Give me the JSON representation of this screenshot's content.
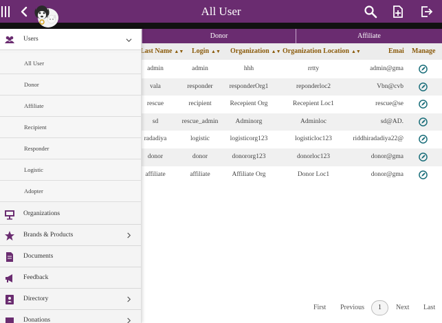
{
  "header": {
    "title": "All User",
    "color": "#6a2c70",
    "icons": [
      "menu-icon",
      "back-icon",
      "search-icon",
      "add-page-icon",
      "logout-icon"
    ]
  },
  "tabs": [
    {
      "label": "Donor"
    },
    {
      "label": "Affiliate"
    }
  ],
  "table": {
    "columns": [
      "Last Name",
      "Login",
      "Organization",
      "Organization Location",
      "Emai",
      "Manage"
    ],
    "rows": [
      {
        "last_name": "admin",
        "login": "admin",
        "organization": "hhh",
        "location": "rrtty",
        "email": "admin@gma"
      },
      {
        "last_name": "vala",
        "login": "responder",
        "organization": "responderOrg1",
        "location": "reponderloc2",
        "email": "Vbn@cvb"
      },
      {
        "last_name": "rescue",
        "login": "recipient",
        "organization": "Recepient Org",
        "location": "Recepient Loc1",
        "email": "rescue@se"
      },
      {
        "last_name": "sd",
        "login": "rescue_admin",
        "organization": "Adminorg",
        "location": "Adminloc",
        "email": "sd@AD."
      },
      {
        "last_name": "radadiya",
        "login": "logistic",
        "organization": "logisticorg123",
        "location": "logisticloc123",
        "email": "riddhiradadiya22@"
      },
      {
        "last_name": "donor",
        "login": "donor",
        "organization": "donororg123",
        "location": "donorloc123",
        "email": "donor@gma"
      },
      {
        "last_name": "affiliate",
        "login": "affiliate",
        "organization": "Affiliate Org",
        "location": "Donor Loc1",
        "email": "donor@gma"
      }
    ]
  },
  "pagination": {
    "first": "First",
    "previous": "Previous",
    "current": "1",
    "next": "Next",
    "last": "Last"
  },
  "sidebar": {
    "users": {
      "label": "Users",
      "icon": "users-icon"
    },
    "sub_items": [
      "All User",
      "Donor",
      "Affiliate",
      "Recipient",
      "Responder",
      "Logistic",
      "Adopter"
    ],
    "items": [
      {
        "label": "Organizations",
        "icon": "organization-icon"
      },
      {
        "label": "Brands & Products",
        "icon": "star-icon"
      },
      {
        "label": "Documents",
        "icon": "document-icon"
      },
      {
        "label": "Feedback",
        "icon": "megaphone-icon"
      },
      {
        "label": "Directory",
        "icon": "directory-icon"
      },
      {
        "label": "Donations",
        "icon": "donation-icon"
      }
    ]
  },
  "accent": "#1a6e7a"
}
